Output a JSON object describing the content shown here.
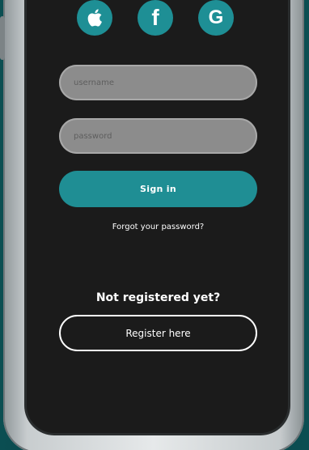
{
  "social": [
    {
      "name": "apple",
      "icon": "apple-icon"
    },
    {
      "name": "facebook",
      "label": "f",
      "icon": "facebook-icon"
    },
    {
      "name": "google",
      "label": "G",
      "icon": "google-icon"
    }
  ],
  "login": {
    "username_placeholder": "username",
    "password_placeholder": "password",
    "signin_label": "Sign in",
    "forgot_label": "Forgot your password?"
  },
  "register": {
    "prompt": "Not registered yet?",
    "button_label": "Register here"
  },
  "colors": {
    "accent": "#1f8e94",
    "screen_bg": "#1b1b1b",
    "field_bg": "#8c8c8c",
    "page_bg": "#0b4e52"
  }
}
